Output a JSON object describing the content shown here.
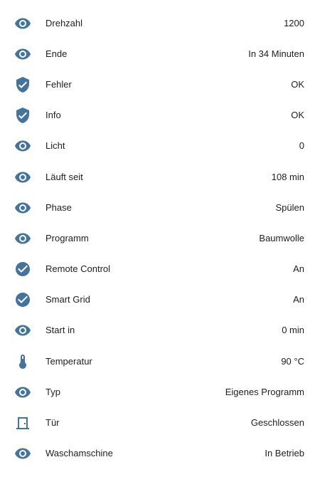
{
  "accent_color": "#44739e",
  "entities": [
    {
      "icon": "eye-icon",
      "label": "Drehzahl",
      "value": "1200"
    },
    {
      "icon": "eye-icon",
      "label": "Ende",
      "value": "In 34 Minuten"
    },
    {
      "icon": "shield-check-icon",
      "label": "Fehler",
      "value": "OK"
    },
    {
      "icon": "shield-check-icon",
      "label": "Info",
      "value": "OK"
    },
    {
      "icon": "eye-icon",
      "label": "Licht",
      "value": "0"
    },
    {
      "icon": "eye-icon",
      "label": "Läuft seit",
      "value": "108 min"
    },
    {
      "icon": "eye-icon",
      "label": "Phase",
      "value": "Spülen"
    },
    {
      "icon": "eye-icon",
      "label": "Programm",
      "value": "Baumwolle"
    },
    {
      "icon": "check-circle-icon",
      "label": "Remote Control",
      "value": "An"
    },
    {
      "icon": "check-circle-icon",
      "label": "Smart Grid",
      "value": "An"
    },
    {
      "icon": "eye-icon",
      "label": "Start in",
      "value": "0 min"
    },
    {
      "icon": "thermometer-icon",
      "label": "Temperatur",
      "value": "90 °C"
    },
    {
      "icon": "eye-icon",
      "label": "Typ",
      "value": "Eigenes Programm"
    },
    {
      "icon": "door-closed-icon",
      "label": "Tür",
      "value": "Geschlossen"
    },
    {
      "icon": "eye-icon",
      "label": "Waschamschine",
      "value": "In Betrieb"
    }
  ]
}
